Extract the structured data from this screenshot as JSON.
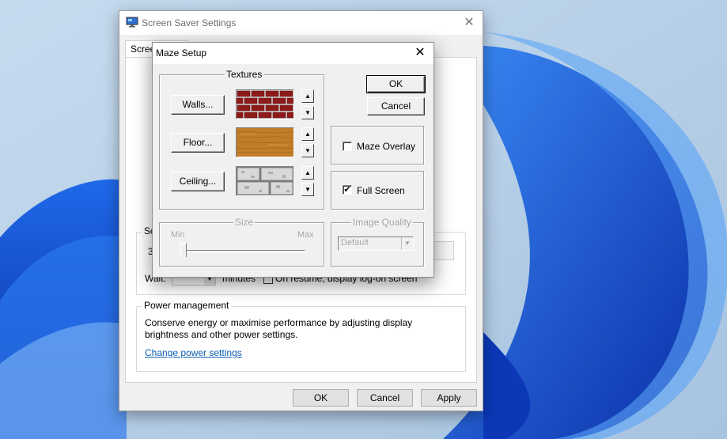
{
  "screen_saver_window": {
    "title": "Screen Saver Settings",
    "tab_label": "Screen",
    "partial_value": "3",
    "wait_label": "Wait:",
    "minutes_label": "minutes",
    "resume_label": "On resume, display log-on screen",
    "group_partial_label": "Sc",
    "power_management": {
      "label": "Power management",
      "description": "Conserve energy or maximise performance by adjusting display brightness and other power settings.",
      "link": "Change power settings"
    },
    "buttons": {
      "ok": "OK",
      "cancel": "Cancel",
      "apply": "Apply"
    }
  },
  "maze_setup": {
    "title": "Maze Setup",
    "textures_label": "Textures",
    "walls_button": "Walls...",
    "floor_button": "Floor...",
    "ceiling_button": "Ceiling...",
    "ok_button": "OK",
    "cancel_button": "Cancel",
    "maze_overlay": {
      "label": "Maze Overlay",
      "checked": false
    },
    "full_screen": {
      "label": "Full Screen",
      "checked": true,
      "mark": "✔"
    },
    "size": {
      "label": "Size",
      "min_label": "Min",
      "max_label": "Max",
      "value": 0
    },
    "image_quality": {
      "label": "Image Quality",
      "selected": "Default"
    }
  },
  "icons": {
    "close": "✕",
    "spin_up": "▲",
    "spin_down": "▼",
    "dropdown": "▼"
  },
  "colors": {
    "link": "#0b5fb3",
    "wallpaper_blue": "#1a4fd6",
    "brick": "#8e1a1a",
    "wood": "#c07d2a"
  }
}
